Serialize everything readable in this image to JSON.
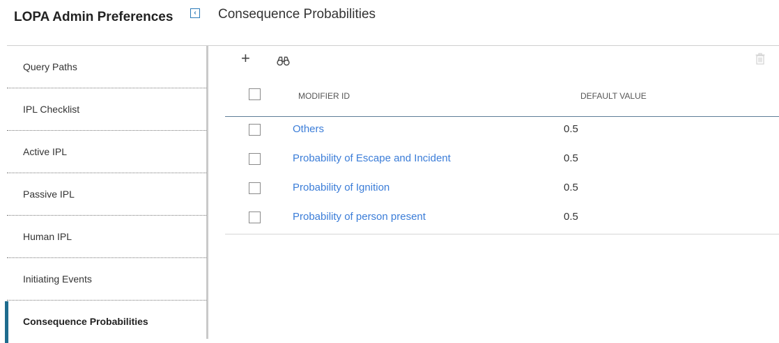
{
  "header": {
    "app_title": "LOPA Admin Preferences",
    "collapse_glyph": "‹",
    "page_title": "Consequence Probabilities"
  },
  "sidebar": {
    "items": [
      {
        "label": "Query Paths",
        "active": false
      },
      {
        "label": "IPL Checklist",
        "active": false
      },
      {
        "label": "Active IPL",
        "active": false
      },
      {
        "label": "Passive IPL",
        "active": false
      },
      {
        "label": "Human IPL",
        "active": false
      },
      {
        "label": "Initiating Events",
        "active": false
      },
      {
        "label": "Consequence Probabilities",
        "active": true
      }
    ],
    "accent_color": "#1e6c8e"
  },
  "toolbar": {
    "add_icon": "+",
    "search_icon": "binoculars-icon",
    "delete_icon": "trash-icon"
  },
  "grid": {
    "columns": [
      "MODIFIER ID",
      "DEFAULT VALUE"
    ],
    "rows": [
      {
        "modifier_id": "Others",
        "default_value": "0.5"
      },
      {
        "modifier_id": "Probability of Escape and Incident",
        "default_value": "0.5"
      },
      {
        "modifier_id": "Probability of Ignition",
        "default_value": "0.5"
      },
      {
        "modifier_id": "Probability of person present",
        "default_value": "0.5"
      }
    ],
    "link_color": "#3b7dd8"
  }
}
